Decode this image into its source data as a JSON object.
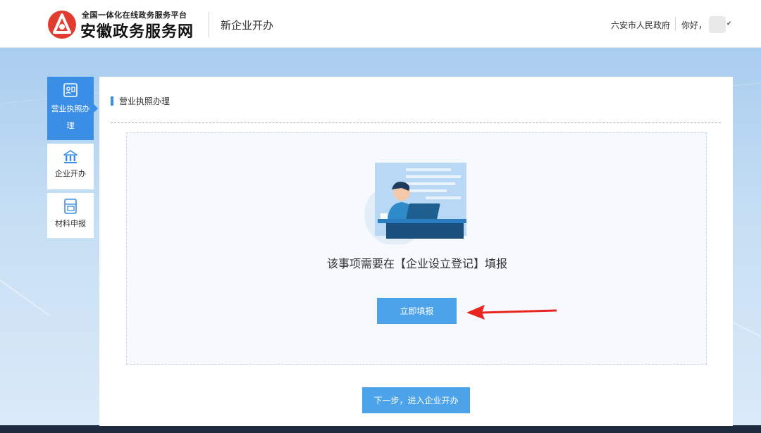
{
  "header": {
    "logo_subtitle": "全国一体化在线政务服务平台",
    "logo_title": "安徽政务服务网",
    "page_title": "新企业开办",
    "city_link": "六安市人民政府",
    "greeting": "你好，",
    "brand_color": "#e23b30"
  },
  "sidebar": {
    "items": [
      {
        "label": "营业执照办理",
        "icon": "license-icon",
        "active": true
      },
      {
        "label": "企业开办",
        "icon": "bank-building-icon",
        "active": false
      },
      {
        "label": "材料申报",
        "icon": "document-folder-icon",
        "active": false
      }
    ],
    "active_color": "#3a8ee6"
  },
  "main": {
    "section_title": "营业执照办理",
    "notice": "该事项需要在【企业设立登记】填报",
    "fill_button": "立即填报",
    "next_button": "下一步，进入企业开办",
    "button_color": "#4da3ea",
    "annotation_arrow_color": "#e8251f"
  }
}
